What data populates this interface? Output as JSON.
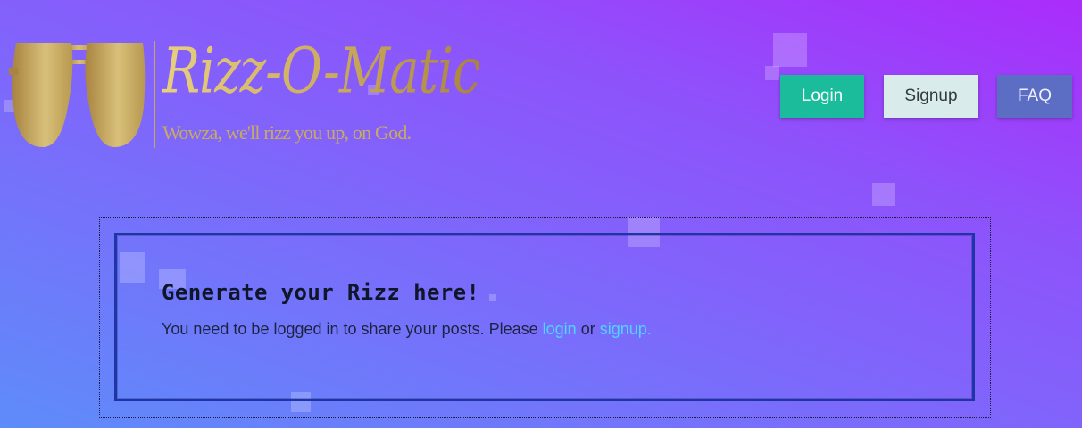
{
  "logo": {
    "title": "Rizz-O-Matic",
    "tagline": "Wowza, we'll rizz you up, on God."
  },
  "nav": {
    "login_label": "Login",
    "signup_label": "Signup",
    "faq_label": "FAQ"
  },
  "panel": {
    "title": "Generate your Rizz here!",
    "message_prefix": "You need to be logged in to share your posts. Please",
    "login_link": "login",
    "or_text": "or",
    "signup_link": "signup."
  },
  "colors": {
    "login_button": "#1abc9c",
    "signup_button": "#d9ebea",
    "faq_button": "#5c6ec3",
    "link": "#4fd6ff",
    "panel_border": "#1e35a8",
    "logo_gold": "#c9ab5f"
  }
}
